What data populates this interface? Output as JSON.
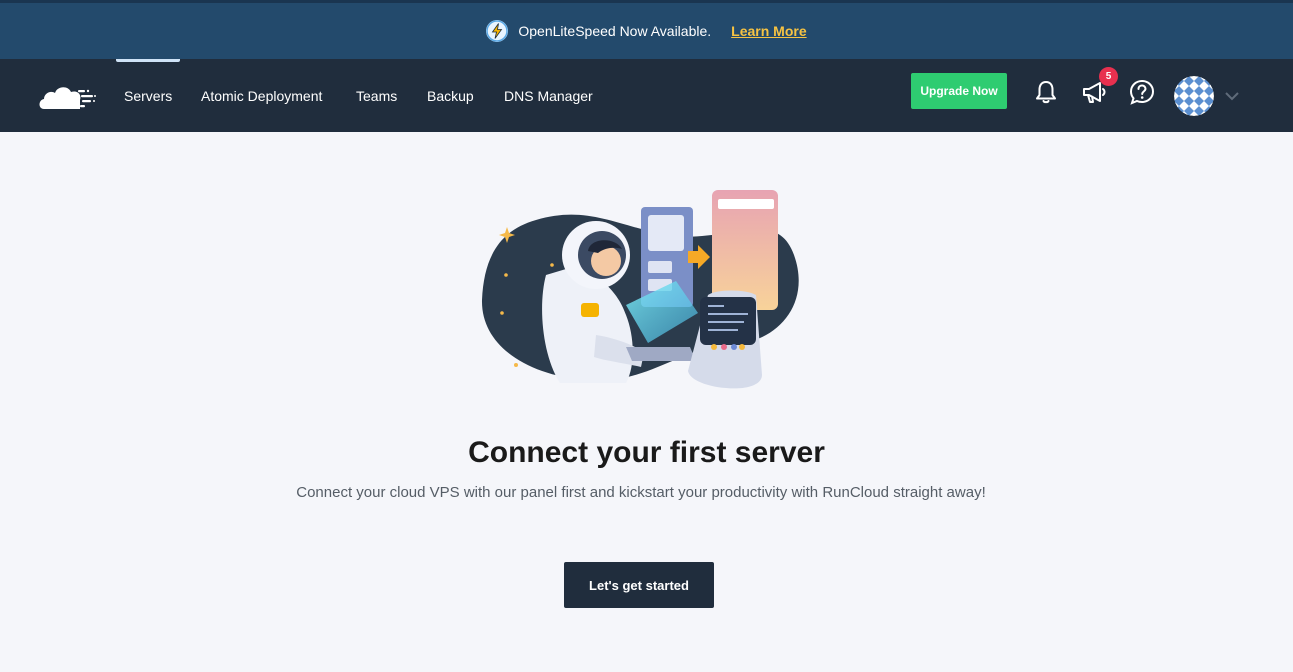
{
  "announcement": {
    "message": "OpenLiteSpeed Now Available.",
    "link_label": "Learn More",
    "link_color": "#f6c343"
  },
  "nav": {
    "items": [
      {
        "label": "Servers",
        "active": true
      },
      {
        "label": "Atomic Deployment",
        "active": false
      },
      {
        "label": "Teams",
        "active": false
      },
      {
        "label": "Backup",
        "active": false
      },
      {
        "label": "DNS Manager",
        "active": false
      }
    ],
    "upgrade_label": "Upgrade Now",
    "upgrade_color": "#2ecc71",
    "notifications_icon": "bell-icon",
    "announcements_icon": "megaphone-icon",
    "announcements_badge": "5",
    "help_icon": "question-circle-icon",
    "account_menu_icon": "chevron-down-icon"
  },
  "main": {
    "title": "Connect your first server",
    "subtitle": "Connect your cloud VPS with our panel first and kickstart your productivity with RunCloud straight away!",
    "cta_label": "Let's get started"
  },
  "colors": {
    "announce_bg": "#234a6c",
    "nav_bg": "#202d3d",
    "page_bg": "#f5f6fa",
    "badge": "#e8304f"
  }
}
